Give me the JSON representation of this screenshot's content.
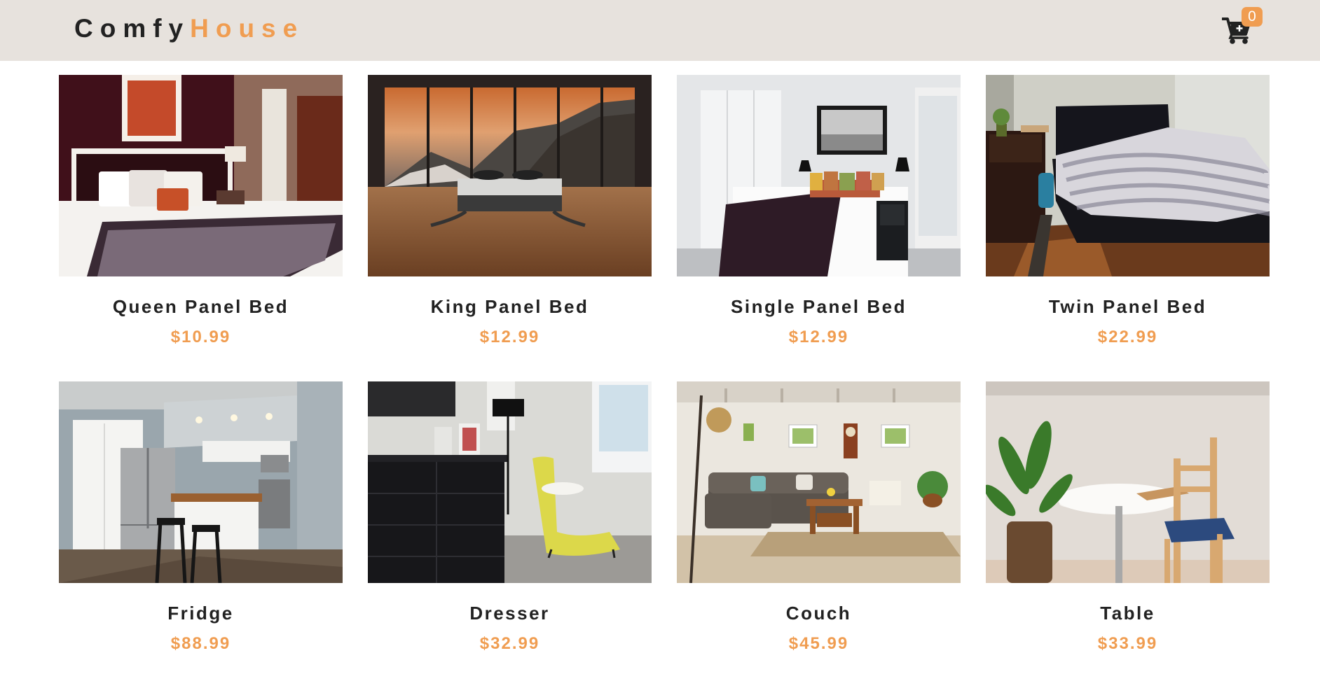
{
  "header": {
    "logo_part1": "Comfy",
    "logo_part2": "House",
    "cart_count": "0",
    "accent_color": "#f09d51",
    "background_color": "#e7e2dd"
  },
  "products": [
    {
      "title": "Queen Panel Bed",
      "price": "$10.99",
      "icon": "bedroom-photo"
    },
    {
      "title": "King Panel Bed",
      "price": "$12.99",
      "icon": "bedroom-photo"
    },
    {
      "title": "Single Panel Bed",
      "price": "$12.99",
      "icon": "bedroom-photo"
    },
    {
      "title": "Twin Panel Bed",
      "price": "$22.99",
      "icon": "bedroom-photo"
    },
    {
      "title": "Fridge",
      "price": "$88.99",
      "icon": "kitchen-photo"
    },
    {
      "title": "Dresser",
      "price": "$32.99",
      "icon": "dresser-photo"
    },
    {
      "title": "Couch",
      "price": "$45.99",
      "icon": "living-room-photo"
    },
    {
      "title": "Table",
      "price": "$33.99",
      "icon": "table-photo"
    }
  ]
}
